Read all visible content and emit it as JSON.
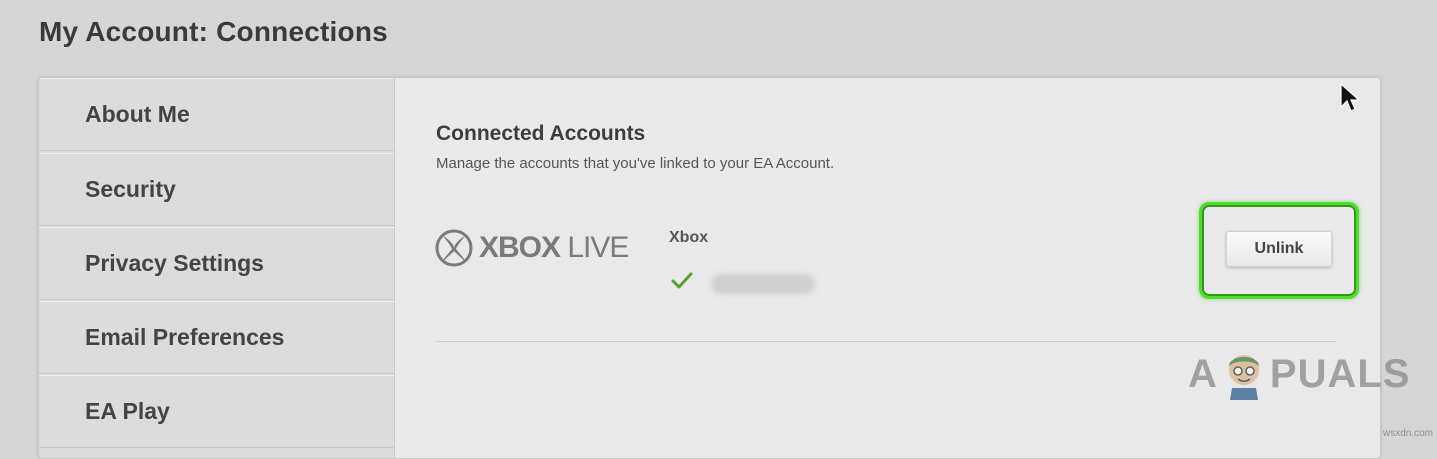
{
  "page": {
    "title": "My Account: Connections"
  },
  "sidebar": {
    "items": [
      {
        "label": "About Me"
      },
      {
        "label": "Security"
      },
      {
        "label": "Privacy Settings"
      },
      {
        "label": "Email Preferences"
      },
      {
        "label": "EA Play"
      }
    ]
  },
  "connected_accounts": {
    "title": "Connected Accounts",
    "description": "Manage the accounts that you've linked to your EA Account.",
    "accounts": [
      {
        "provider_logo_text_1": "XBOX",
        "provider_logo_text_2": "LIVE",
        "name": "Xbox",
        "status_icon": "check-icon",
        "unlink_label": "Unlink"
      }
    ]
  },
  "watermark": {
    "brand_prefix": "A",
    "brand_suffix": "PUALS",
    "site": "wsxdn.com"
  },
  "colors": {
    "highlight": "#4fdc2c",
    "check": "#5aa02c"
  }
}
